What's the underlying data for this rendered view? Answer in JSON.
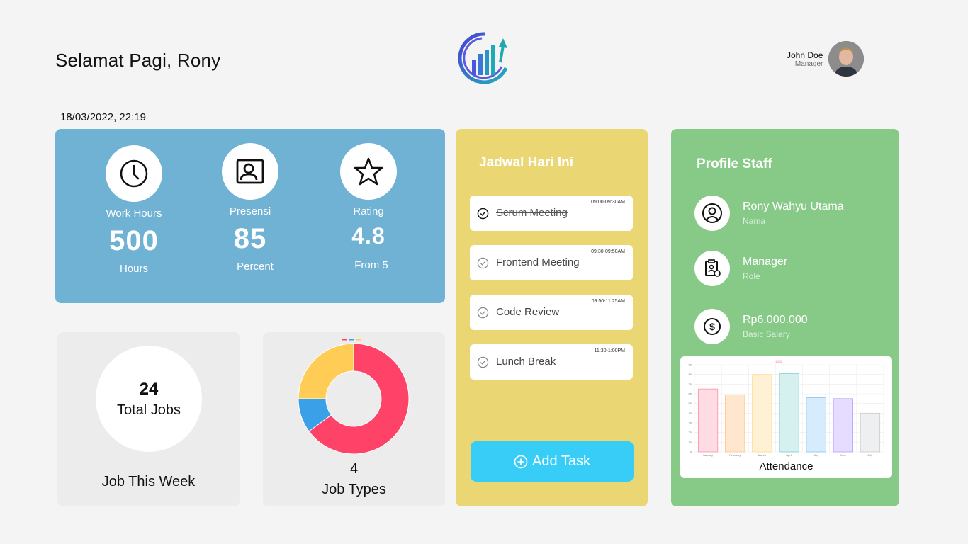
{
  "header": {
    "greeting": "Selamat Pagi, Rony",
    "user_name": "John Doe",
    "user_role": "Manager",
    "datetime": "18/03/2022, 22:19"
  },
  "stats": [
    {
      "icon": "clock-icon",
      "label": "Work Hours",
      "value": "500",
      "unit": "Hours"
    },
    {
      "icon": "id-card-icon",
      "label": "Presensi",
      "value": "85",
      "unit": "Percent"
    },
    {
      "icon": "star-icon",
      "label": "Rating",
      "value": "4.8",
      "unit": "From 5"
    }
  ],
  "jobs": {
    "count": "24",
    "count_label": "Total Jobs",
    "caption": "Job This Week"
  },
  "job_types": {
    "count": "4",
    "label": "Job Types"
  },
  "schedule": {
    "title": "Jadwal Hari Ini",
    "tasks": [
      {
        "name": "Scrum Meeting",
        "time": "09:00-09:30AM",
        "done": true
      },
      {
        "name": "Frontend Meeting",
        "time": "09:30-09:50AM",
        "done": false
      },
      {
        "name": "Code Review",
        "time": "09:50-11:25AM",
        "done": false
      },
      {
        "name": "Lunch Break",
        "time": "11:30-1:00PM",
        "done": false
      }
    ],
    "add_label": "Add Task"
  },
  "profile": {
    "title": "Profile Staff",
    "name": "Rony Wahyu Utama",
    "name_key": "Nama",
    "role": "Manager",
    "role_key": "Role",
    "salary": "Rp6.000.000",
    "salary_key": "Basic Salary",
    "attendance_label": "Attendance"
  },
  "colors": {
    "stats_bg": "#6fb2d4",
    "schedule_bg": "#ead672",
    "profile_bg": "#87c987",
    "add_button": "#38cdf7",
    "donut": [
      "#ff4268",
      "#3aa0e8",
      "#ffcd56"
    ]
  },
  "chart_data": [
    {
      "type": "pie",
      "labels": [],
      "values": [
        65,
        10,
        25
      ],
      "colors": [
        "#ff4268",
        "#3aa0e8",
        "#ffcd56"
      ]
    },
    {
      "type": "bar",
      "categories": [
        "January",
        "February",
        "March",
        "April",
        "May",
        "June",
        "July"
      ],
      "values": [
        65,
        59,
        80,
        81,
        56,
        55,
        40
      ],
      "ylim": [
        0,
        90
      ],
      "colors": [
        "#ffdbe3",
        "#ffe7cf",
        "#fff2d4",
        "#d6f0f0",
        "#d6ebfb",
        "#e6dcff",
        "#eeeff1"
      ],
      "border_colors": [
        "#ff8fa8",
        "#ffc28a",
        "#ffd98a",
        "#7ccfcf",
        "#8cc4f0",
        "#b49cff",
        "#c9cbcf"
      ],
      "legend": "top"
    }
  ]
}
